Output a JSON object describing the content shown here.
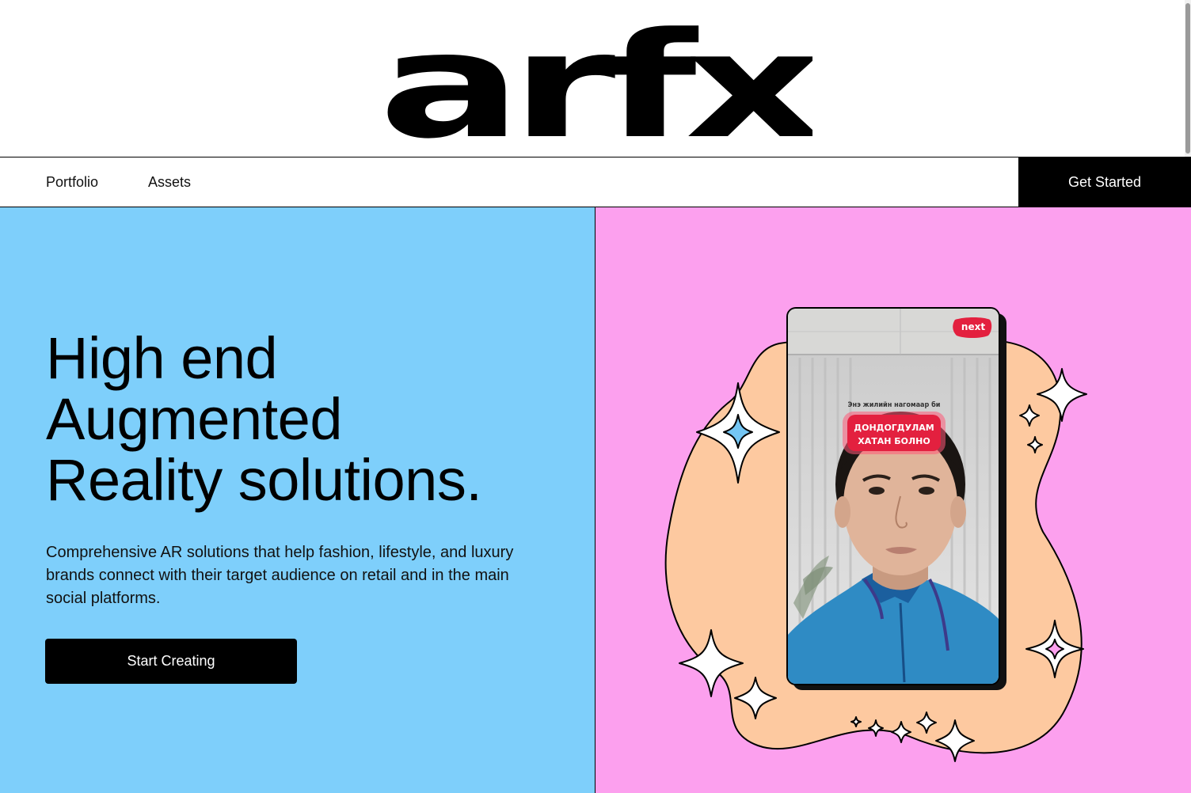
{
  "brand": {
    "logo_text": "arfx"
  },
  "nav": {
    "links": [
      {
        "label": "Portfolio"
      },
      {
        "label": "Assets"
      }
    ],
    "cta_label": "Get Started"
  },
  "hero": {
    "headline_lines": [
      "High end",
      "Augmented",
      "Reality solutions."
    ],
    "description": "Comprehensive AR solutions that help fashion, lifestyle, and luxury brands connect with their target audience on retail and in the main social platforms.",
    "cta_label": "Start Creating",
    "phone": {
      "badge": "next",
      "banner_small": "Энэ жилийн нагомаар би",
      "banner_line1": "ДОНДОГДУЛАМ",
      "banner_line2": "ХАТАН БОЛНО"
    }
  },
  "colors": {
    "left_panel": "#7ecffb",
    "right_panel": "#fca0ee",
    "blob": "#fdc9a0",
    "accent_black": "#000000"
  }
}
